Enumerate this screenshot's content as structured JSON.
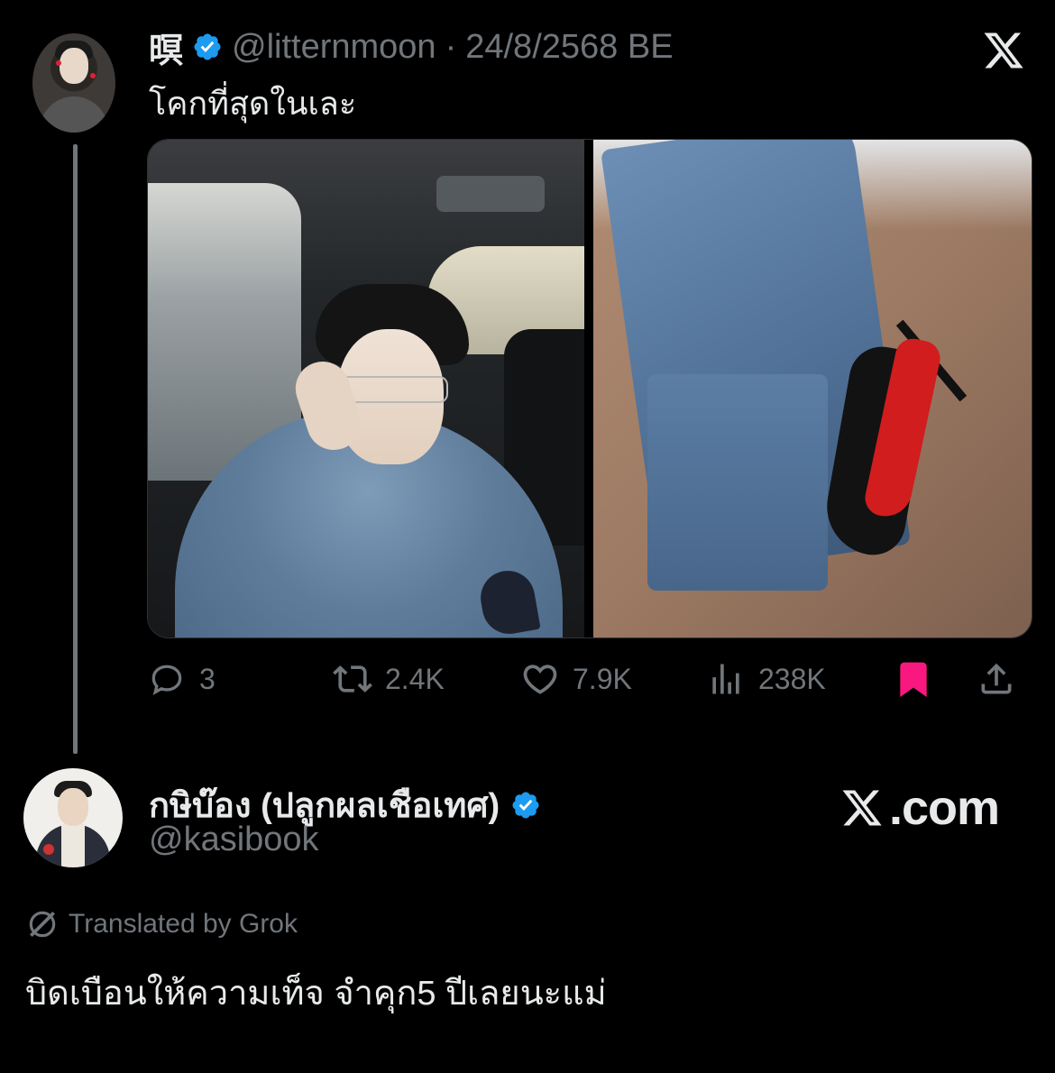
{
  "tweet": {
    "display_name": "暝",
    "handle": "@litternmoon",
    "separator": "·",
    "date": "24/8/2568 BE",
    "text": "โคกที่สุดในเละ",
    "stats": {
      "replies": "3",
      "reposts": "2.4K",
      "likes": "7.9K",
      "views": "238K"
    },
    "bookmarked": true
  },
  "account": {
    "display_name": "กษิบ๊อง (ปลูกผลเชือเทศ)",
    "handle": "@kasibook",
    "site": "com",
    "translated_label": "Translated by Grok",
    "text": "บิดเบือนให้ความเท็จ จำคุก5 ปีเลยนะแม่"
  },
  "colors": {
    "background": "#000000",
    "text": "#e7e9ea",
    "muted": "#71767b",
    "verified": "#1d9bf0",
    "bookmark": "#f91880"
  },
  "icons": {
    "close": "x-logo-icon",
    "reply": "reply-icon",
    "repost": "repost-icon",
    "like": "heart-icon",
    "views": "views-icon",
    "bookmark": "bookmark-icon",
    "share": "share-icon",
    "grok": "grok-icon",
    "verified": "verified-badge-icon"
  }
}
